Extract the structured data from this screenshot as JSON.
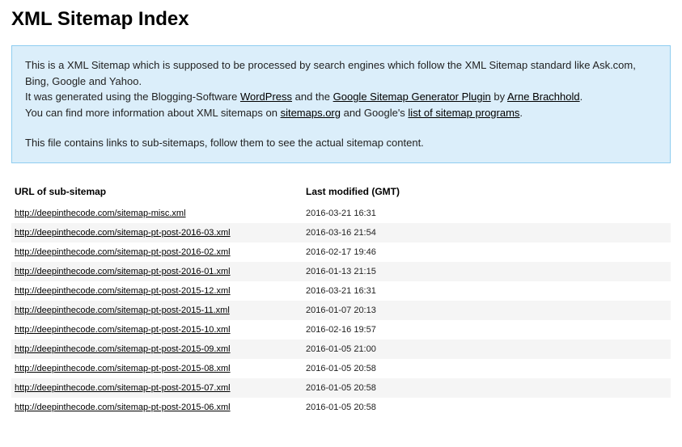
{
  "title": "XML Sitemap Index",
  "info": {
    "line1_pre": "This is a XML Sitemap which is supposed to be processed by search engines which follow the XML Sitemap standard like Ask.com, Bing, Google and Yahoo.",
    "line2_pre": "It was generated using the Blogging-Software ",
    "link_wordpress": "WordPress",
    "line2_mid": " and the ",
    "link_gsg": "Google Sitemap Generator Plugin",
    "line2_by": " by ",
    "link_author": "Arne Brachhold",
    "line2_end": ".",
    "line3_pre": "You can find more information about XML sitemaps on ",
    "link_sitemaps": "sitemaps.org",
    "line3_mid": " and Google's ",
    "link_list": "list of sitemap programs",
    "line3_end": ".",
    "line4": "This file contains links to sub-sitemaps, follow them to see the actual sitemap content."
  },
  "headers": {
    "url": "URL of sub-sitemap",
    "modified": "Last modified (GMT)"
  },
  "rows": [
    {
      "url": "http://deepinthecode.com/sitemap-misc.xml",
      "modified": "2016-03-21 16:31"
    },
    {
      "url": "http://deepinthecode.com/sitemap-pt-post-2016-03.xml",
      "modified": "2016-03-16 21:54"
    },
    {
      "url": "http://deepinthecode.com/sitemap-pt-post-2016-02.xml",
      "modified": "2016-02-17 19:46"
    },
    {
      "url": "http://deepinthecode.com/sitemap-pt-post-2016-01.xml",
      "modified": "2016-01-13 21:15"
    },
    {
      "url": "http://deepinthecode.com/sitemap-pt-post-2015-12.xml",
      "modified": "2016-03-21 16:31"
    },
    {
      "url": "http://deepinthecode.com/sitemap-pt-post-2015-11.xml",
      "modified": "2016-01-07 20:13"
    },
    {
      "url": "http://deepinthecode.com/sitemap-pt-post-2015-10.xml",
      "modified": "2016-02-16 19:57"
    },
    {
      "url": "http://deepinthecode.com/sitemap-pt-post-2015-09.xml",
      "modified": "2016-01-05 21:00"
    },
    {
      "url": "http://deepinthecode.com/sitemap-pt-post-2015-08.xml",
      "modified": "2016-01-05 20:58"
    },
    {
      "url": "http://deepinthecode.com/sitemap-pt-post-2015-07.xml",
      "modified": "2016-01-05 20:58"
    },
    {
      "url": "http://deepinthecode.com/sitemap-pt-post-2015-06.xml",
      "modified": "2016-01-05 20:58"
    }
  ]
}
